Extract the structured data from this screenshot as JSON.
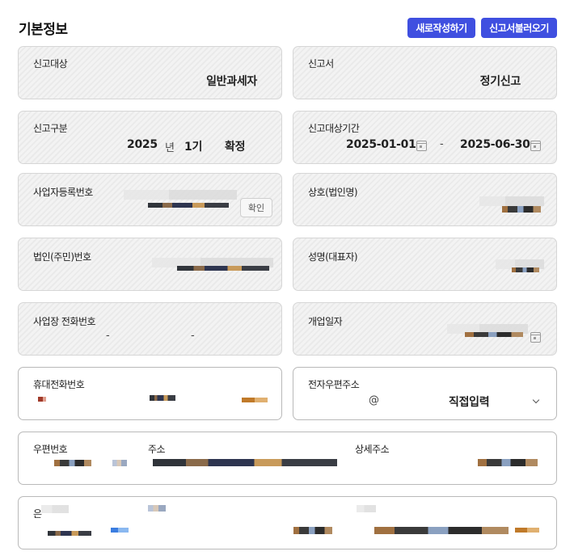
{
  "header": {
    "title": "기본정보",
    "new_button": "새로작성하기",
    "load_button": "신고서불러오기"
  },
  "fields": {
    "report_target": {
      "label": "신고대상",
      "value": "일반과세자"
    },
    "report_type": {
      "label": "신고서",
      "value": "정기신고"
    },
    "report_class": {
      "label": "신고구분",
      "year": "2025",
      "year_unit": "년",
      "term": "1기",
      "kind": "확정"
    },
    "report_period": {
      "label": "신고대상기간",
      "start": "2025-01-01",
      "separator": "-",
      "end": "2025-06-30"
    },
    "business_reg_no": {
      "label": "사업자등록번호",
      "confirm_button": "확인"
    },
    "company_name": {
      "label": "상호(법인명)"
    },
    "corp_reg_no": {
      "label": "법인(주민)번호"
    },
    "representative": {
      "label": "성명(대표자)"
    },
    "business_phone": {
      "label": "사업장 전화번호",
      "sep1": "-",
      "sep2": "-"
    },
    "opening_date": {
      "label": "개업일자"
    },
    "mobile": {
      "label": "휴대전화번호"
    },
    "email": {
      "label": "전자우편주소",
      "at": "@",
      "domain_select": "직접입력"
    },
    "address": {
      "zip_label": "우편번호",
      "addr_label": "주소",
      "detail_label": "상세주소"
    },
    "bank": {
      "label_fragment": "은"
    }
  },
  "colors": {
    "primary_button": "#3f4fe0"
  },
  "icons": {
    "calendar": "calendar-icon",
    "dropdown": "chevron-down-icon"
  }
}
